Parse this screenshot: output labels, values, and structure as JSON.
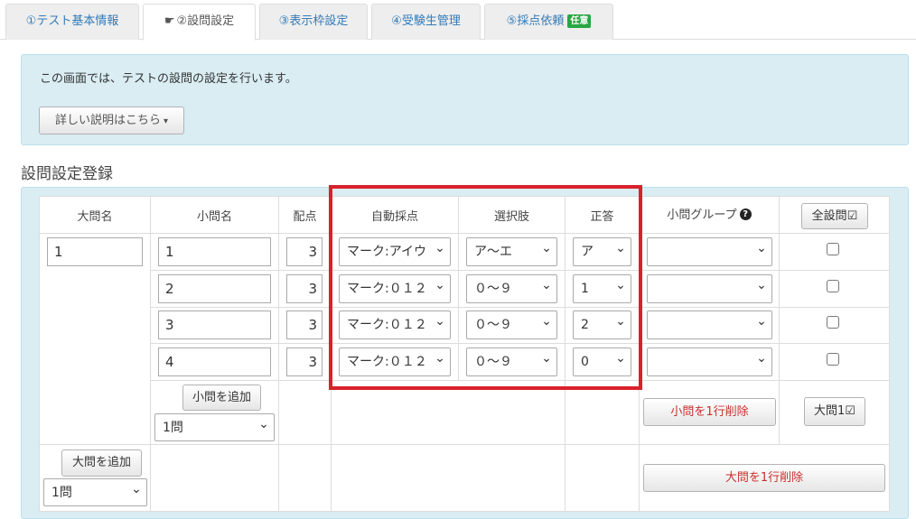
{
  "tabs": [
    {
      "label": "①テスト基本情報"
    },
    {
      "label": "②設問設定",
      "hand": "☛"
    },
    {
      "label": "③表示枠設定"
    },
    {
      "label": "④受験生管理"
    },
    {
      "label": "⑤採点依頼",
      "badge": "任意"
    }
  ],
  "info": {
    "text": "この画面では、テストの設問の設定を行います。",
    "detail_button": "詳しい説明はこちら",
    "caret": "▾"
  },
  "section_title": "設問設定登録",
  "table": {
    "headers": {
      "daimon": "大問名",
      "shomon": "小問名",
      "haiten": "配点",
      "auto": "自動採点",
      "choices": "選択肢",
      "answer": "正答",
      "group": "小問グループ",
      "help": "?",
      "all_button": "全設問☑"
    },
    "daimon_value": "1",
    "rows": [
      {
        "shomon": "1",
        "haiten": "3",
        "auto": "マーク:アイウ",
        "choices": "ア〜エ",
        "answer": "ア",
        "group": ""
      },
      {
        "shomon": "2",
        "haiten": "3",
        "auto": "マーク:０１２",
        "choices": "０〜９",
        "answer": "1",
        "group": ""
      },
      {
        "shomon": "3",
        "haiten": "3",
        "auto": "マーク:０１２",
        "choices": "０〜９",
        "answer": "2",
        "group": ""
      },
      {
        "shomon": "4",
        "haiten": "3",
        "auto": "マーク:０１２",
        "choices": "０〜９",
        "answer": "0",
        "group": ""
      }
    ],
    "add_shomon_button": "小問を追加",
    "shomon_count": "1問",
    "delete_shomon_button": "小問を1行削除",
    "daimon_check_button": "大問1☑",
    "add_daimon_button": "大問を追加",
    "daimon_count": "1問",
    "delete_daimon_button": "大問を1行削除"
  }
}
